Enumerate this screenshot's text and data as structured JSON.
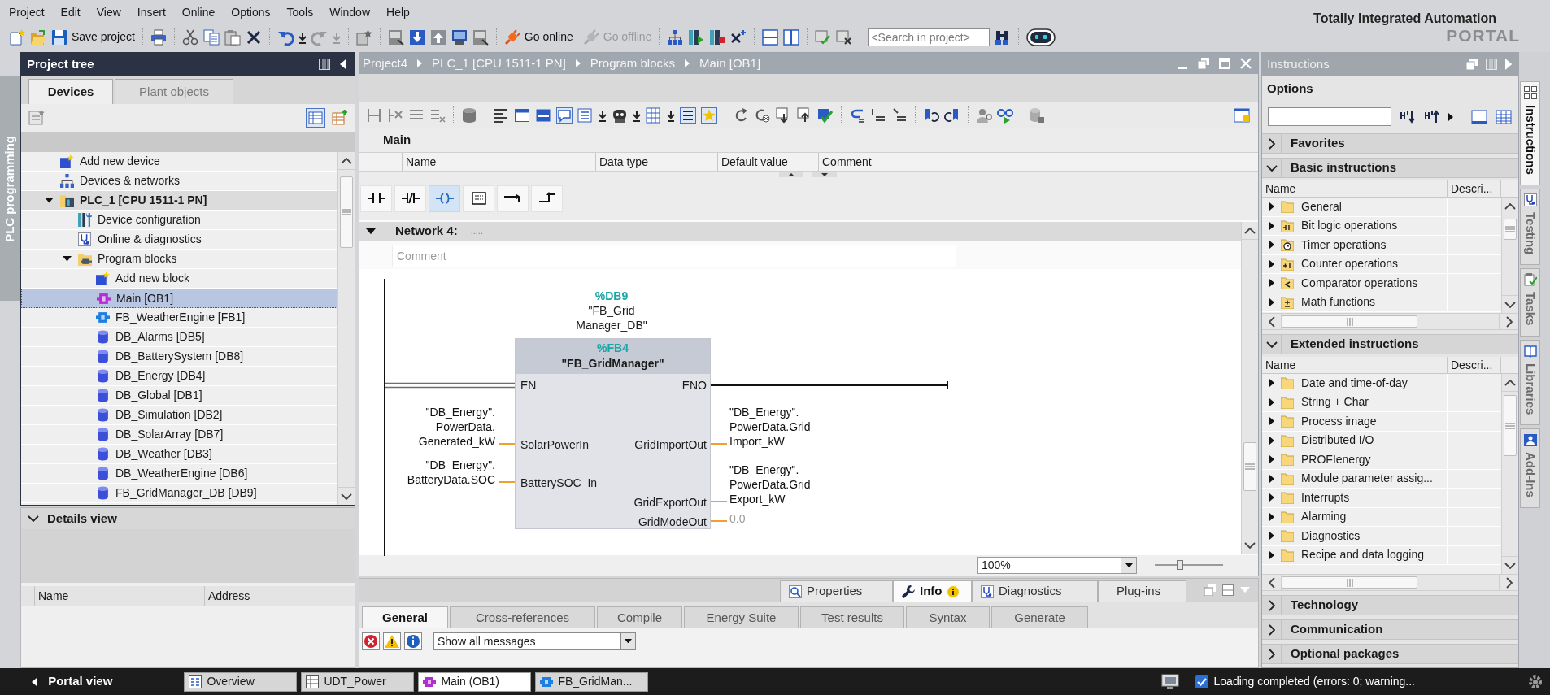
{
  "menu": [
    "Project",
    "Edit",
    "View",
    "Insert",
    "Online",
    "Options",
    "Tools",
    "Window",
    "Help"
  ],
  "toolbar": {
    "buttons": [
      {
        "label": "Save project",
        "disabled": false
      },
      {
        "label": "Go online",
        "disabled": false
      },
      {
        "label": "Go offline",
        "disabled": true
      }
    ],
    "search": {
      "placeholder": "<Search in project>"
    }
  },
  "brand": {
    "line_1": "Totally Integrated Automation",
    "line_2": "PORTAL"
  },
  "left_sidebar_tab": "PLC programming",
  "project_tree": {
    "title": "Project tree",
    "tabs": [
      {
        "label": "Devices",
        "selected": true
      },
      {
        "label": "Plant objects",
        "selected": false
      }
    ],
    "items": [
      {
        "label": "Add new device",
        "kind": "add",
        "selected": false
      },
      {
        "label": "Devices & networks",
        "kind": "network",
        "selected": false
      },
      {
        "label": "PLC_1 [CPU 1511-1 PN]",
        "kind": "plc",
        "selected": false,
        "expanded": true,
        "children": [
          {
            "label": "Device configuration",
            "kind": "config",
            "selected": false
          },
          {
            "label": "Online & diagnostics",
            "kind": "diagnostics",
            "selected": false
          },
          {
            "label": "Program blocks",
            "kind": "folder",
            "selected": false,
            "expanded": true,
            "children": [
              {
                "label": "Add new block",
                "kind": "add",
                "selected": false
              },
              {
                "label": "Main [OB1]",
                "kind": "ob",
                "selected": true
              },
              {
                "label": "FB_WeatherEngine [FB1]",
                "kind": "fb",
                "selected": false
              },
              {
                "label": "DB_Alarms [DB5]",
                "kind": "db",
                "selected": false
              },
              {
                "label": "DB_BatterySystem [DB8]",
                "kind": "db",
                "selected": false
              },
              {
                "label": "DB_Energy [DB4]",
                "kind": "db",
                "selected": false
              },
              {
                "label": "DB_Global [DB1]",
                "kind": "db",
                "selected": false
              },
              {
                "label": "DB_Simulation [DB2]",
                "kind": "db",
                "selected": false
              },
              {
                "label": "DB_SolarArray [DB7]",
                "kind": "db",
                "selected": false
              },
              {
                "label": "DB_Weather [DB3]",
                "kind": "db",
                "selected": false
              },
              {
                "label": "DB_WeatherEngine [DB6]",
                "kind": "db",
                "selected": false
              },
              {
                "label": "FB_GridManager_DB [DB9]",
                "kind": "db",
                "selected": false
              }
            ]
          }
        ]
      }
    ]
  },
  "details_view": {
    "title": "Details view",
    "expanded": true,
    "columns": [
      "Name",
      "Address"
    ]
  },
  "editor": {
    "breadcrumb": [
      "Project4",
      "PLC_1 [CPU 1511-1 PN]",
      "Program blocks",
      "Main [OB1]"
    ],
    "block_title": "Main",
    "interface_columns": [
      "Name",
      "Data type",
      "Default value",
      "Comment"
    ],
    "lad_palette": [
      {
        "kind": "contact_no",
        "selected": false
      },
      {
        "kind": "contact_nc",
        "selected": false
      },
      {
        "kind": "coil",
        "selected": true
      },
      {
        "kind": "box",
        "selected": false
      },
      {
        "kind": "open_branch",
        "selected": false
      },
      {
        "kind": "close_branch",
        "selected": false
      }
    ],
    "network": {
      "title": "Network 4:",
      "title_comment": ".....",
      "expanded": true,
      "comment_placeholder": "Comment",
      "instance": {
        "address": "%DB9",
        "name": [
          "\"FB_Grid",
          "Manager_DB\""
        ]
      },
      "block": {
        "address": "%FB4",
        "name": "\"FB_GridManager\"",
        "en": "EN",
        "eno": "ENO",
        "inputs": [
          {
            "pin": "SolarPowerIn",
            "operand": [
              "\"DB_Energy\".",
              "PowerData.",
              "Generated_kW"
            ],
            "kind": "variable"
          },
          {
            "pin": "BatterySOC_In",
            "operand": [
              "\"DB_Energy\".",
              "BatteryData.SOC"
            ],
            "kind": "variable"
          }
        ],
        "outputs": [
          {
            "pin": "GridImportOut",
            "operand": [
              "\"DB_Energy\".",
              "PowerData.Grid",
              "Import_kW"
            ],
            "kind": "variable"
          },
          {
            "pin": "GridExportOut",
            "operand": [
              "\"DB_Energy\".",
              "PowerData.Grid",
              "Export_kW"
            ],
            "kind": "variable"
          },
          {
            "pin": "GridModeOut",
            "operand": [
              "0.0"
            ],
            "kind": "default"
          }
        ]
      }
    },
    "zoom": "100%",
    "zoom_slider": {
      "level": 0.35
    }
  },
  "inspector": {
    "tabs": [
      {
        "label": "Properties",
        "kind": "properties",
        "selected": false
      },
      {
        "label": "Info",
        "kind": "info",
        "selected": true
      },
      {
        "label": "Diagnostics",
        "kind": "diagnostics",
        "selected": false
      },
      {
        "label": "Plug-ins",
        "kind": "plugins",
        "selected": false
      }
    ],
    "subtabs": [
      {
        "label": "General",
        "selected": true
      },
      {
        "label": "Cross-references",
        "selected": false
      },
      {
        "label": "Compile",
        "selected": false
      },
      {
        "label": "Energy Suite",
        "selected": false
      },
      {
        "label": "Test results",
        "selected": false
      },
      {
        "label": "Syntax",
        "selected": false
      },
      {
        "label": "Generate",
        "selected": false
      }
    ],
    "filter": "Show all messages"
  },
  "instructions": {
    "title": "Instructions",
    "options_title": "Options",
    "sections": [
      {
        "label": "Favorites",
        "expanded": false
      },
      {
        "label": "Basic instructions",
        "expanded": true,
        "columns": [
          "Name",
          "Descri..."
        ],
        "items": [
          {
            "label": "General",
            "kind": "folder",
            "expanded": false
          },
          {
            "label": "Bit logic operations",
            "kind": "bit_logic",
            "expanded": false
          },
          {
            "label": "Timer operations",
            "kind": "timer",
            "expanded": false
          },
          {
            "label": "Counter operations",
            "kind": "counter",
            "expanded": false
          },
          {
            "label": "Comparator operations",
            "kind": "comparator",
            "expanded": false
          },
          {
            "label": "Math functions",
            "kind": "math",
            "expanded": false
          }
        ]
      },
      {
        "label": "Extended instructions",
        "expanded": true,
        "columns": [
          "Name",
          "Descri..."
        ],
        "items": [
          {
            "label": "Date and time-of-day",
            "kind": "folder",
            "expanded": false
          },
          {
            "label": "String + Char",
            "kind": "folder",
            "expanded": false
          },
          {
            "label": "Process image",
            "kind": "folder",
            "expanded": false
          },
          {
            "label": "Distributed I/O",
            "kind": "folder",
            "expanded": false
          },
          {
            "label": "PROFIenergy",
            "kind": "folder",
            "expanded": false
          },
          {
            "label": "Module parameter assig...",
            "kind": "folder",
            "expanded": false
          },
          {
            "label": "Interrupts",
            "kind": "folder",
            "expanded": false
          },
          {
            "label": "Alarming",
            "kind": "folder",
            "expanded": false
          },
          {
            "label": "Diagnostics",
            "kind": "folder",
            "expanded": false
          },
          {
            "label": "Recipe and data logging",
            "kind": "folder",
            "expanded": false
          }
        ]
      },
      {
        "label": "Technology",
        "expanded": false
      },
      {
        "label": "Communication",
        "expanded": false
      },
      {
        "label": "Optional packages",
        "expanded": false
      }
    ]
  },
  "side_tabs": [
    {
      "label": "Instructions",
      "kind": "instructions",
      "selected": true
    },
    {
      "label": "Testing",
      "kind": "testing",
      "selected": false
    },
    {
      "label": "Tasks",
      "kind": "tasks",
      "selected": false
    },
    {
      "label": "Libraries",
      "kind": "libraries",
      "selected": false
    },
    {
      "label": "Add-Ins",
      "kind": "addins",
      "selected": false
    }
  ],
  "taskbar": {
    "portal_view": "Portal view",
    "items": [
      {
        "label": "Overview",
        "kind": "overview",
        "selected": false
      },
      {
        "label": "UDT_Power",
        "kind": "table",
        "selected": false
      },
      {
        "label": "Main (OB1)",
        "kind": "ob",
        "selected": true
      },
      {
        "label": "FB_GridMan...",
        "kind": "fb",
        "selected": false
      }
    ],
    "status": "Loading completed (errors: 0; warning..."
  }
}
